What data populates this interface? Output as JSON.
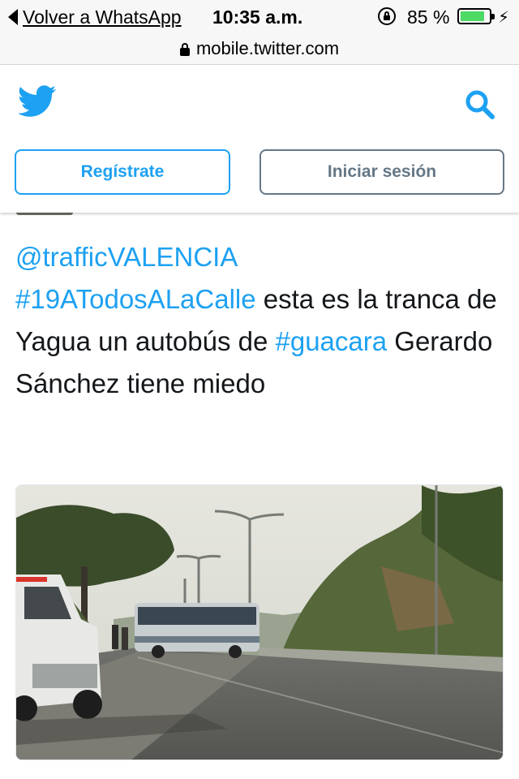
{
  "status_bar": {
    "back_label": "Volver a WhatsApp",
    "time": "10:35 a.m.",
    "battery_percent": "85 %",
    "battery_level": 0.85,
    "battery_color": "#4cd964"
  },
  "url_bar": {
    "url": "mobile.twitter.com"
  },
  "header": {
    "logo_icon": "twitter-bird-icon",
    "search_icon": "search-icon",
    "signup_label": "Regístrate",
    "login_label": "Iniciar sesión",
    "brand_color": "#1da1f2"
  },
  "tweet": {
    "mention": "@trafficVALENCIA",
    "hashtag1": "#19ATodosALaCalle",
    "text1": " esta es la tranca de Yagua un autobús de ",
    "hashtag2": "#guacara",
    "text2": " Gerardo Sánchez tiene miedo"
  }
}
